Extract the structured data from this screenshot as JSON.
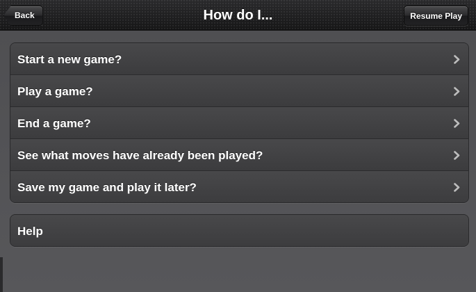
{
  "navbar": {
    "title": "How do I...",
    "back_label": "Back",
    "resume_label": "Resume Play"
  },
  "questions": [
    {
      "label": "Start a new game?"
    },
    {
      "label": "Play a game?"
    },
    {
      "label": "End a game?"
    },
    {
      "label": "See what moves have already been played?"
    },
    {
      "label": "Save my game and play it later?"
    }
  ],
  "help": {
    "label": "Help"
  },
  "icons": {
    "row_disclosure": "chevron-right-icon",
    "back": "back-arrow-shape"
  },
  "colors": {
    "background": "#545457",
    "navbar": "#1c1c1e",
    "cell": "#424244",
    "text": "#ffffff",
    "chevron": "#bdbdbd"
  }
}
